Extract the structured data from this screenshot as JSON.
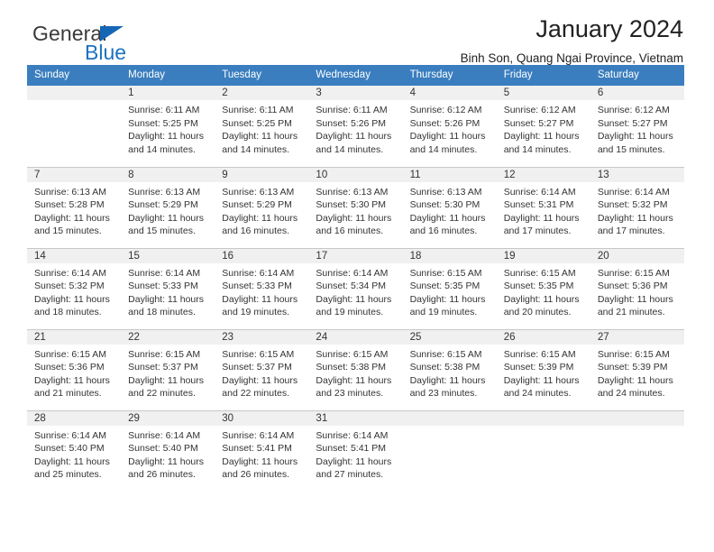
{
  "brand": {
    "name_part1": "General",
    "name_part2": "Blue",
    "logo_icon": "triangle-icon",
    "accent_color": "#1c72c0"
  },
  "header": {
    "title": "January 2024",
    "subtitle": "Binh Son, Quang Ngai Province, Vietnam"
  },
  "calendar": {
    "header_bg": "#3a7ebf",
    "daynum_bg": "#f0f0f0",
    "weekday_headers": [
      "Sunday",
      "Monday",
      "Tuesday",
      "Wednesday",
      "Thursday",
      "Friday",
      "Saturday"
    ],
    "weeks": [
      [
        {
          "day": "",
          "sunrise": "",
          "sunset": "",
          "daylight1": "",
          "daylight2": "",
          "empty": true
        },
        {
          "day": "1",
          "sunrise": "Sunrise: 6:11 AM",
          "sunset": "Sunset: 5:25 PM",
          "daylight1": "Daylight: 11 hours",
          "daylight2": "and 14 minutes."
        },
        {
          "day": "2",
          "sunrise": "Sunrise: 6:11 AM",
          "sunset": "Sunset: 5:25 PM",
          "daylight1": "Daylight: 11 hours",
          "daylight2": "and 14 minutes."
        },
        {
          "day": "3",
          "sunrise": "Sunrise: 6:11 AM",
          "sunset": "Sunset: 5:26 PM",
          "daylight1": "Daylight: 11 hours",
          "daylight2": "and 14 minutes."
        },
        {
          "day": "4",
          "sunrise": "Sunrise: 6:12 AM",
          "sunset": "Sunset: 5:26 PM",
          "daylight1": "Daylight: 11 hours",
          "daylight2": "and 14 minutes."
        },
        {
          "day": "5",
          "sunrise": "Sunrise: 6:12 AM",
          "sunset": "Sunset: 5:27 PM",
          "daylight1": "Daylight: 11 hours",
          "daylight2": "and 14 minutes."
        },
        {
          "day": "6",
          "sunrise": "Sunrise: 6:12 AM",
          "sunset": "Sunset: 5:27 PM",
          "daylight1": "Daylight: 11 hours",
          "daylight2": "and 15 minutes."
        }
      ],
      [
        {
          "day": "7",
          "sunrise": "Sunrise: 6:13 AM",
          "sunset": "Sunset: 5:28 PM",
          "daylight1": "Daylight: 11 hours",
          "daylight2": "and 15 minutes."
        },
        {
          "day": "8",
          "sunrise": "Sunrise: 6:13 AM",
          "sunset": "Sunset: 5:29 PM",
          "daylight1": "Daylight: 11 hours",
          "daylight2": "and 15 minutes."
        },
        {
          "day": "9",
          "sunrise": "Sunrise: 6:13 AM",
          "sunset": "Sunset: 5:29 PM",
          "daylight1": "Daylight: 11 hours",
          "daylight2": "and 16 minutes."
        },
        {
          "day": "10",
          "sunrise": "Sunrise: 6:13 AM",
          "sunset": "Sunset: 5:30 PM",
          "daylight1": "Daylight: 11 hours",
          "daylight2": "and 16 minutes."
        },
        {
          "day": "11",
          "sunrise": "Sunrise: 6:13 AM",
          "sunset": "Sunset: 5:30 PM",
          "daylight1": "Daylight: 11 hours",
          "daylight2": "and 16 minutes."
        },
        {
          "day": "12",
          "sunrise": "Sunrise: 6:14 AM",
          "sunset": "Sunset: 5:31 PM",
          "daylight1": "Daylight: 11 hours",
          "daylight2": "and 17 minutes."
        },
        {
          "day": "13",
          "sunrise": "Sunrise: 6:14 AM",
          "sunset": "Sunset: 5:32 PM",
          "daylight1": "Daylight: 11 hours",
          "daylight2": "and 17 minutes."
        }
      ],
      [
        {
          "day": "14",
          "sunrise": "Sunrise: 6:14 AM",
          "sunset": "Sunset: 5:32 PM",
          "daylight1": "Daylight: 11 hours",
          "daylight2": "and 18 minutes."
        },
        {
          "day": "15",
          "sunrise": "Sunrise: 6:14 AM",
          "sunset": "Sunset: 5:33 PM",
          "daylight1": "Daylight: 11 hours",
          "daylight2": "and 18 minutes."
        },
        {
          "day": "16",
          "sunrise": "Sunrise: 6:14 AM",
          "sunset": "Sunset: 5:33 PM",
          "daylight1": "Daylight: 11 hours",
          "daylight2": "and 19 minutes."
        },
        {
          "day": "17",
          "sunrise": "Sunrise: 6:14 AM",
          "sunset": "Sunset: 5:34 PM",
          "daylight1": "Daylight: 11 hours",
          "daylight2": "and 19 minutes."
        },
        {
          "day": "18",
          "sunrise": "Sunrise: 6:15 AM",
          "sunset": "Sunset: 5:35 PM",
          "daylight1": "Daylight: 11 hours",
          "daylight2": "and 19 minutes."
        },
        {
          "day": "19",
          "sunrise": "Sunrise: 6:15 AM",
          "sunset": "Sunset: 5:35 PM",
          "daylight1": "Daylight: 11 hours",
          "daylight2": "and 20 minutes."
        },
        {
          "day": "20",
          "sunrise": "Sunrise: 6:15 AM",
          "sunset": "Sunset: 5:36 PM",
          "daylight1": "Daylight: 11 hours",
          "daylight2": "and 21 minutes."
        }
      ],
      [
        {
          "day": "21",
          "sunrise": "Sunrise: 6:15 AM",
          "sunset": "Sunset: 5:36 PM",
          "daylight1": "Daylight: 11 hours",
          "daylight2": "and 21 minutes."
        },
        {
          "day": "22",
          "sunrise": "Sunrise: 6:15 AM",
          "sunset": "Sunset: 5:37 PM",
          "daylight1": "Daylight: 11 hours",
          "daylight2": "and 22 minutes."
        },
        {
          "day": "23",
          "sunrise": "Sunrise: 6:15 AM",
          "sunset": "Sunset: 5:37 PM",
          "daylight1": "Daylight: 11 hours",
          "daylight2": "and 22 minutes."
        },
        {
          "day": "24",
          "sunrise": "Sunrise: 6:15 AM",
          "sunset": "Sunset: 5:38 PM",
          "daylight1": "Daylight: 11 hours",
          "daylight2": "and 23 minutes."
        },
        {
          "day": "25",
          "sunrise": "Sunrise: 6:15 AM",
          "sunset": "Sunset: 5:38 PM",
          "daylight1": "Daylight: 11 hours",
          "daylight2": "and 23 minutes."
        },
        {
          "day": "26",
          "sunrise": "Sunrise: 6:15 AM",
          "sunset": "Sunset: 5:39 PM",
          "daylight1": "Daylight: 11 hours",
          "daylight2": "and 24 minutes."
        },
        {
          "day": "27",
          "sunrise": "Sunrise: 6:15 AM",
          "sunset": "Sunset: 5:39 PM",
          "daylight1": "Daylight: 11 hours",
          "daylight2": "and 24 minutes."
        }
      ],
      [
        {
          "day": "28",
          "sunrise": "Sunrise: 6:14 AM",
          "sunset": "Sunset: 5:40 PM",
          "daylight1": "Daylight: 11 hours",
          "daylight2": "and 25 minutes."
        },
        {
          "day": "29",
          "sunrise": "Sunrise: 6:14 AM",
          "sunset": "Sunset: 5:40 PM",
          "daylight1": "Daylight: 11 hours",
          "daylight2": "and 26 minutes."
        },
        {
          "day": "30",
          "sunrise": "Sunrise: 6:14 AM",
          "sunset": "Sunset: 5:41 PM",
          "daylight1": "Daylight: 11 hours",
          "daylight2": "and 26 minutes."
        },
        {
          "day": "31",
          "sunrise": "Sunrise: 6:14 AM",
          "sunset": "Sunset: 5:41 PM",
          "daylight1": "Daylight: 11 hours",
          "daylight2": "and 27 minutes."
        },
        {
          "day": "",
          "sunrise": "",
          "sunset": "",
          "daylight1": "",
          "daylight2": "",
          "empty": true
        },
        {
          "day": "",
          "sunrise": "",
          "sunset": "",
          "daylight1": "",
          "daylight2": "",
          "empty": true
        },
        {
          "day": "",
          "sunrise": "",
          "sunset": "",
          "daylight1": "",
          "daylight2": "",
          "empty": true
        }
      ]
    ]
  }
}
